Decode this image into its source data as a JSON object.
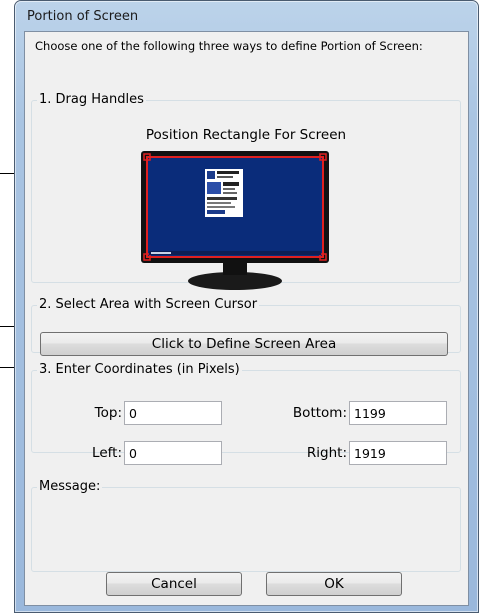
{
  "window": {
    "title": "Portion of Screen"
  },
  "intro": "Choose one of the following three ways to define Portion of Screen:",
  "drag": {
    "legend": "1. Drag Handles",
    "preview_label": "Position Rectangle For Screen"
  },
  "select": {
    "legend": "2. Select Area with Screen Cursor",
    "button_label": "Click to Define Screen Area"
  },
  "coords": {
    "legend": "3. Enter Coordinates (in Pixels)",
    "top_label": "Top:",
    "top_value": "0",
    "bottom_label": "Bottom:",
    "bottom_value": "1199",
    "left_label": "Left:",
    "left_value": "0",
    "right_label": "Right:",
    "right_value": "1919"
  },
  "message": {
    "legend": "Message:",
    "text": ""
  },
  "buttons": {
    "cancel": "Cancel",
    "ok": "OK"
  },
  "colors": {
    "frame": "#9ab8dc",
    "monitor_screen": "#0a2c7a",
    "handle": "#e02020"
  }
}
